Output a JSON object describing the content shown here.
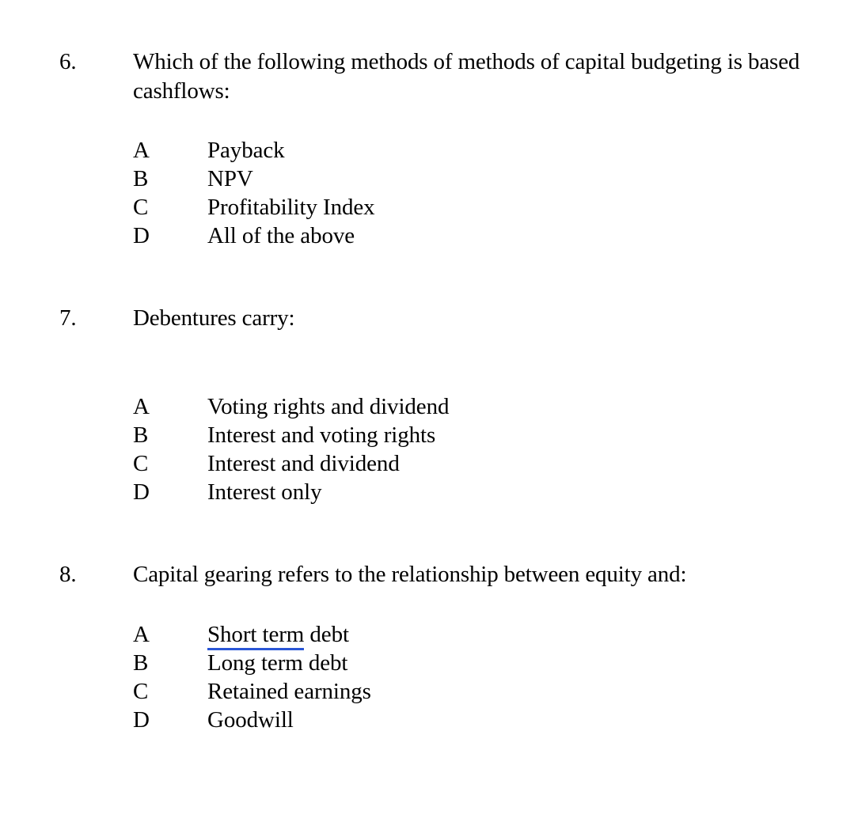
{
  "document": {
    "background_color": "#ffffff",
    "text_color": "#000000",
    "highlight_underline_color": "#2a56d6"
  },
  "questions": [
    {
      "number": "6.",
      "text_line1": "Which of the following methods of methods of capital budgeting is based",
      "text_line2": "cashflows:",
      "options": [
        {
          "letter": "A",
          "text": "Payback"
        },
        {
          "letter": "B",
          "text": "NPV"
        },
        {
          "letter": "C",
          "text": "Profitability Index"
        },
        {
          "letter": "D",
          "text": "All of the above"
        }
      ]
    },
    {
      "number": "7.",
      "text_line1": "Debentures carry:",
      "text_line2": "",
      "options": [
        {
          "letter": "A",
          "text": "Voting rights and dividend"
        },
        {
          "letter": "B",
          "text": "Interest and voting rights"
        },
        {
          "letter": "C",
          "text": "Interest and dividend"
        },
        {
          "letter": "D",
          "text": "Interest only"
        }
      ]
    },
    {
      "number": "8.",
      "text_line1": "Capital gearing refers to the relationship between equity and:",
      "text_line2": "",
      "options": [
        {
          "letter": "A",
          "text_underlined": "Short term",
          "text_plain": " debt"
        },
        {
          "letter": "B",
          "text": "Long term debt"
        },
        {
          "letter": "C",
          "text": "Retained earnings"
        },
        {
          "letter": "D",
          "text": "Goodwill"
        }
      ]
    }
  ]
}
